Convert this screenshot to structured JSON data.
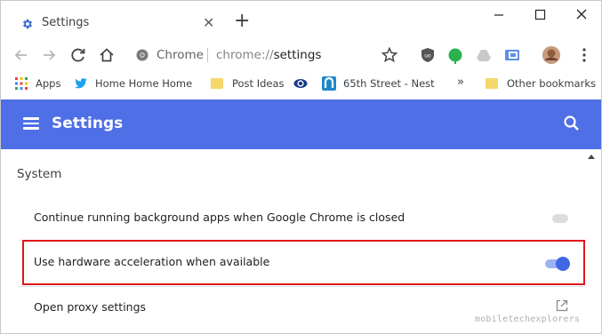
{
  "tab": {
    "title": "Settings",
    "favicon": "settings-gear-icon"
  },
  "omnibox": {
    "site_name": "Chrome",
    "url_scheme": "chrome://",
    "url_path": "settings"
  },
  "bookmarks": [
    {
      "label": "Apps",
      "icon": "apps-grid-icon"
    },
    {
      "label": "Home Home Home",
      "icon": "twitter-icon"
    },
    {
      "label": "Post Ideas",
      "icon": "folder-icon"
    },
    {
      "label": "",
      "icon": "cbs-eye-icon"
    },
    {
      "label": "65th Street - Nest",
      "icon": "nest-icon"
    },
    {
      "label": "»",
      "icon": ""
    },
    {
      "label": "Other bookmarks",
      "icon": "folder-icon"
    }
  ],
  "header": {
    "title": "Settings"
  },
  "section": {
    "title": "System"
  },
  "settings": [
    {
      "label": "Continue running background apps when Google Chrome is closed",
      "control": "toggle",
      "enabled": false
    },
    {
      "label": "Use hardware acceleration when available",
      "control": "toggle",
      "enabled": true,
      "highlighted": true
    },
    {
      "label": "Open proxy settings",
      "control": "external-link"
    }
  ],
  "watermark": "mobiletechexplorers",
  "colors": {
    "header_bg": "#4f6fe6",
    "toggle_on": "#4267e4",
    "highlight_border": "#e0171a"
  }
}
